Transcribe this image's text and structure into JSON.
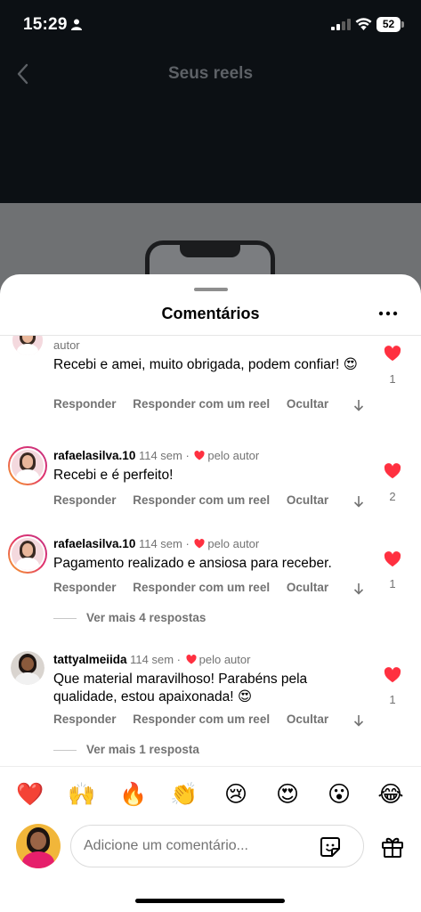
{
  "status_bar": {
    "time": "15:29",
    "battery": "52"
  },
  "background": {
    "title": "Seus reels"
  },
  "sheet": {
    "title": "Comentários"
  },
  "actions": {
    "reply": "Responder",
    "reply_reel": "Responder com um reel",
    "hide": "Ocultar"
  },
  "comments": [
    {
      "author_badge": "autor",
      "text": "Recebi e amei, muito obrigada, podem confiar! 😍",
      "likes": "1"
    },
    {
      "username": "rafaelasilva.10",
      "time": "114 sem",
      "liked_by": "pelo autor",
      "text": "Recebi e é perfeito!",
      "likes": "2"
    },
    {
      "username": "rafaelasilva.10",
      "time": "114 sem",
      "liked_by": "pelo autor",
      "text": "Pagamento realizado e ansiosa para receber.",
      "likes": "1",
      "more_replies": "Ver mais 4 respostas"
    },
    {
      "username": "tattyalmeiida",
      "time": "114 sem",
      "liked_by": "pelo autor",
      "text": "Que material maravilhoso! Parabéns pela qualidade, estou apaixonada! 😍",
      "likes": "1",
      "more_replies": "Ver mais 1 resposta"
    }
  ],
  "emoji_bar": [
    "❤️",
    "🙌",
    "🔥",
    "👏",
    "😢",
    "😍",
    "😮",
    "😂"
  ],
  "composer": {
    "placeholder": "Adicione um comentário..."
  },
  "colors": {
    "like_red": "#ff3040",
    "meta_grey": "#737373",
    "background_dark": "#0c1014"
  },
  "icons": [
    "person-icon",
    "signal-icon",
    "wifi-icon",
    "back-icon",
    "more-icon",
    "heart-icon",
    "arrow-down-icon",
    "sticker-icon",
    "gift-icon"
  ]
}
